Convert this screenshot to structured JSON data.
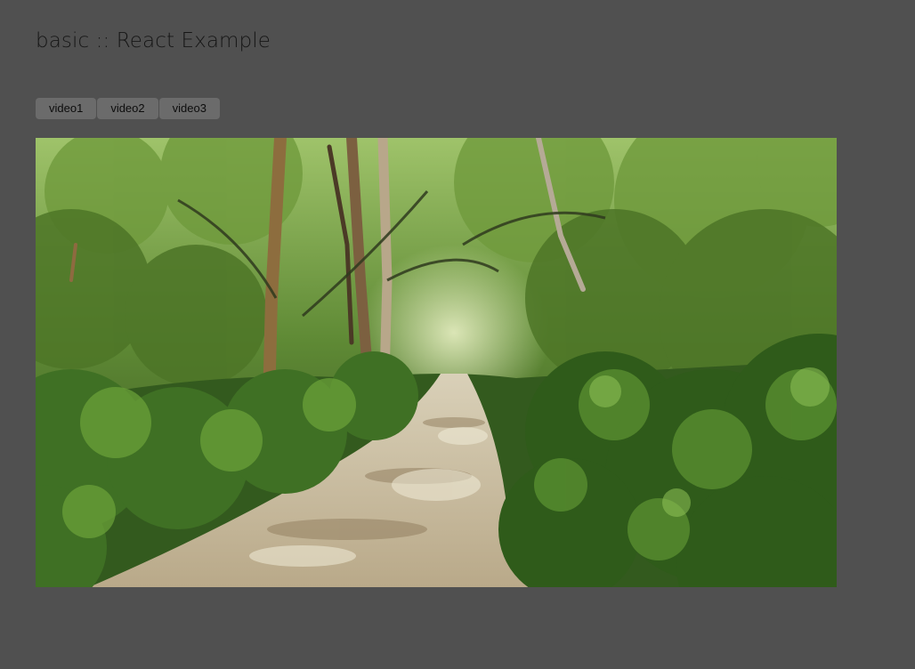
{
  "page": {
    "title": "basic :: React Example"
  },
  "controls": {
    "buttons": [
      {
        "label": "video1"
      },
      {
        "label": "video2"
      },
      {
        "label": "video3"
      }
    ]
  },
  "player": {
    "scene": "forest-path"
  },
  "colors": {
    "background": "#505050",
    "button": "#6b6b6b",
    "title_text": "#161616"
  }
}
